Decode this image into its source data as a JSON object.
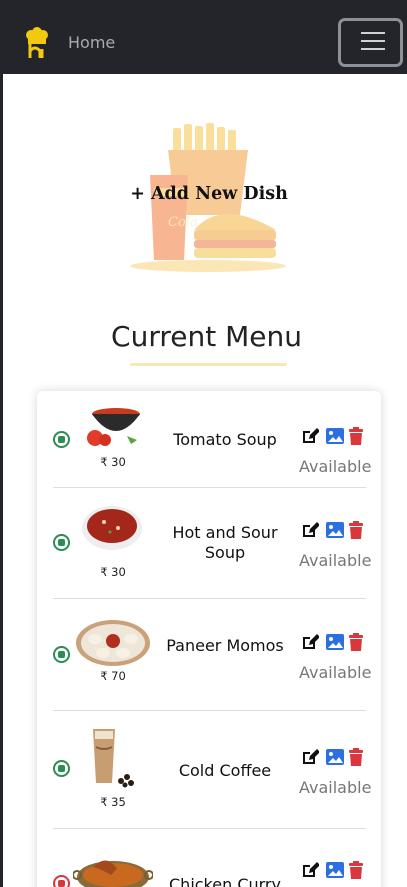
{
  "navbar": {
    "home_label": "Home"
  },
  "hero": {
    "add_dish_label": "+ Add New Dish",
    "cup_text": "Cola"
  },
  "menu": {
    "title": "Current Menu",
    "items": [
      {
        "name": "Tomato Soup",
        "price": "₹ 30",
        "status": "Available",
        "diet": "veg"
      },
      {
        "name": "Hot and Sour Soup",
        "price": "₹ 30",
        "status": "Available",
        "diet": "veg"
      },
      {
        "name": "Paneer Momos",
        "price": "₹ 70",
        "status": "Available",
        "diet": "veg"
      },
      {
        "name": "Cold Coffee",
        "price": "₹ 35",
        "status": "Available",
        "diet": "veg"
      },
      {
        "name": "Chicken Curry",
        "price": "",
        "status": "",
        "diet": "non-veg"
      }
    ]
  },
  "colors": {
    "navbar": "#23252a",
    "veg": "#2c8c55",
    "non_veg": "#d9363e",
    "edit_icon": "#111111",
    "image_icon": "#2b6fe0",
    "delete_icon": "#d9363e",
    "accent": "#fbe7b3"
  }
}
